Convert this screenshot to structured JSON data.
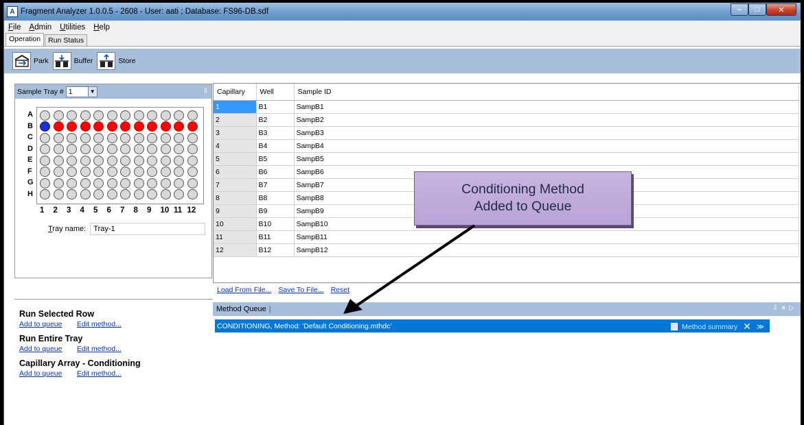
{
  "window": {
    "title": "Fragment Analyzer 1.0.0.5 - 2608 - User: aati ; Database: FS96-DB.sdf"
  },
  "menu": [
    "File",
    "Admin",
    "Utilities",
    "Help"
  ],
  "tabs": [
    "Operation",
    "Run Status"
  ],
  "toolbar": [
    {
      "label": "Park",
      "icon": "park-icon"
    },
    {
      "label": "Buffer",
      "icon": "buffer-icon"
    },
    {
      "label": "Store",
      "icon": "store-icon"
    }
  ],
  "sample_tray": {
    "label": "Sample Tray #",
    "value": "1",
    "rows": [
      "A",
      "B",
      "C",
      "D",
      "E",
      "F",
      "G",
      "H"
    ],
    "columns": [
      "1",
      "2",
      "3",
      "4",
      "5",
      "6",
      "7",
      "8",
      "9",
      "10",
      "11",
      "12"
    ],
    "tray_name_label": "Tray name:",
    "tray_name_value": "Tray-1",
    "well_states": {
      "B": [
        "blue",
        "red",
        "red",
        "red",
        "red",
        "red",
        "red",
        "red",
        "red",
        "red",
        "red",
        "red"
      ]
    }
  },
  "sample_grid": {
    "headers": [
      "Capillary",
      "Well",
      "Sample ID"
    ],
    "rows": [
      [
        "1",
        "B1",
        "SampB1"
      ],
      [
        "2",
        "B2",
        "SampB2"
      ],
      [
        "3",
        "B3",
        "SampB3"
      ],
      [
        "4",
        "B4",
        "SampB4"
      ],
      [
        "5",
        "B5",
        "SampB5"
      ],
      [
        "6",
        "B6",
        "SampB6"
      ],
      [
        "7",
        "B7",
        "SampB7"
      ],
      [
        "8",
        "B8",
        "SampB8"
      ],
      [
        "9",
        "B9",
        "SampB9"
      ],
      [
        "10",
        "B10",
        "SampB10"
      ],
      [
        "11",
        "B11",
        "SampB11"
      ],
      [
        "12",
        "B12",
        "SampB12"
      ]
    ]
  },
  "file_links": [
    "Load From File...",
    "Save To File...",
    "Reset"
  ],
  "actions": [
    {
      "title": "Run Selected Row",
      "add": "Add to queue",
      "edit": "Edit method..."
    },
    {
      "title": "Run Entire Tray",
      "add": "Add to queue",
      "edit": "Edit method..."
    },
    {
      "title": "Capillary Array - Conditioning",
      "add": "Add to queue",
      "edit": "Edit method..."
    }
  ],
  "method_queue": {
    "label": "Method Queue",
    "items": [
      {
        "text": "CONDITIONING, Method: 'Default Conditioning.mthdc'",
        "summary": "Method summary"
      }
    ]
  },
  "callout": {
    "line1": "Conditioning Method",
    "line2": "Added to Queue"
  },
  "colors": {
    "header_blue": "#a7bfdb",
    "selection_blue": "#0078d7",
    "well_red": "#ff0000",
    "well_blue": "#1e2fd8",
    "callout_purple": "#c8b5e0"
  }
}
